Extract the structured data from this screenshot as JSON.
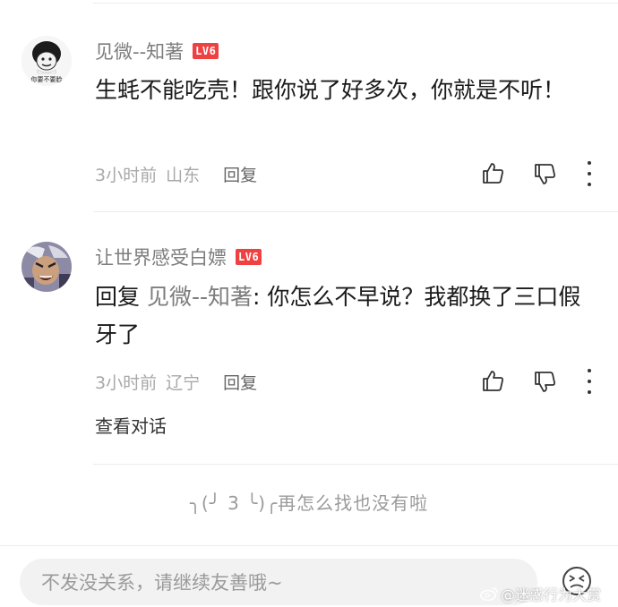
{
  "comments": [
    {
      "username": "见微--知著",
      "level": "LV6",
      "content": "生蚝不能吃壳！跟你说了好多次，你就是不听！",
      "time": "3小时前",
      "location": "山东",
      "reply_label": "回复",
      "avatar_caption": "你要不要脸"
    },
    {
      "username": "让世界感受白嫖",
      "level": "LV6",
      "reply_prefix": "回复",
      "mention": "见微--知著",
      "content": ": 你怎么不早说？我都换了三口假牙了",
      "time": "3小时前",
      "location": "辽宁",
      "reply_label": "回复",
      "view_conversation": "查看对话"
    }
  ],
  "end_message": "╮(╯ 3 ╰)╭再怎么找也没有啦",
  "input": {
    "placeholder": "不发没关系，请继续友善哦~"
  },
  "watermark": "@迷惑行为大赏",
  "colors": {
    "badge": "#f04142",
    "meta": "#a8a8a8",
    "username": "#7d7d7d"
  }
}
